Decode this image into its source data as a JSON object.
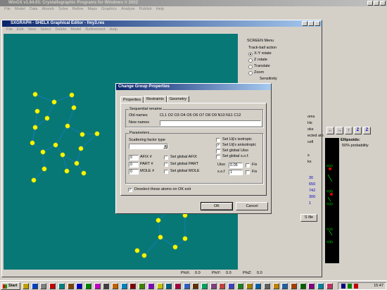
{
  "wingx_window": {
    "title": "WinGX v1.64.03: Crystallographic Programs for Windows © 2002",
    "menu": [
      "File",
      "Model",
      "Data",
      "Absorb",
      "Solve",
      "Refine",
      "Maps",
      "Graphics",
      "Analyse",
      "Publish",
      "Help"
    ]
  },
  "sxgraph_window": {
    "title": "SXGRAPH - SHELX Graphical Editor - fmy3.res",
    "menu": [
      "File",
      "Edit",
      "View",
      "Select",
      "Delete",
      "Model",
      "Refinement",
      "Help"
    ],
    "status": {
      "phix_label": "PhiX:",
      "phix_value": "0.0",
      "phiy_label": "PhiY:",
      "phiy_value": "0.0",
      "phiz_label": "PhiZ:",
      "phiz_value": "0.0"
    }
  },
  "screen_menu": {
    "title": "SCREEN Menu",
    "trackball_label": "Track-ball action",
    "options": [
      "X-Y rotate",
      "Z rotate",
      "Translate",
      "Zoom"
    ],
    "selected": "X-Y rotate",
    "sensitivity_label": "Sensitivity",
    "partial_items": [
      "oms",
      "Hs",
      "oks",
      "ected atoms",
      "cell",
      "s",
      "ks"
    ],
    "partial_values": [
      "30",
      "650",
      "742",
      "300",
      "1"
    ],
    "res_file_button": "S file"
  },
  "side_panel": {
    "ellipsoids_label": "Ellipsoids:",
    "ellipsoids_value": "50% probability",
    "atom_labels": [
      "C(1)",
      "C(3)",
      "C(2)",
      "C(4)",
      "C(5)"
    ]
  },
  "dialog": {
    "title": "Change Group Properties",
    "tabs": [
      "Properties",
      "Restraints",
      "Geometry"
    ],
    "active_tab": "Properties",
    "sequential_rename": {
      "legend": "Sequential rename",
      "old_names_label": "Old names",
      "old_names_value": "CL1 O2 O3 O4 O5 O6 O7 O8 O9 N10 N11 C12",
      "new_names_label": "New names",
      "new_names_value": ""
    },
    "parameters": {
      "legend": "Parameters",
      "scattering_label": "Scattering factor type",
      "scattering_value": "",
      "afix_value": "0",
      "afix_label": "AFIX #",
      "part_value": "0",
      "part_label": "PART #",
      "mole_value": "0",
      "mole_label": "MOLE #",
      "set_global_afix": "Set global AFIX",
      "set_global_part": "Set global PART",
      "set_global_mole": "Set global MOLE",
      "set_uij_iso": "Set Uij's isotropic",
      "set_uij_aniso": "Set Uij's anisotropic",
      "set_global_uiso": "Set global Uiso",
      "set_global_sof": "Set global s.o.f.",
      "uiso_label": "Uiso",
      "uiso_value": "0.05",
      "sof_label": "s.o.f",
      "sof_value": "1",
      "fix_label": "Fix"
    },
    "deselect_label": "Deselect these atoms on OK exit",
    "ok_label": "OK",
    "cancel_label": "Cancel"
  },
  "taskbar": {
    "start_label": "Start",
    "clock": "15:47"
  }
}
